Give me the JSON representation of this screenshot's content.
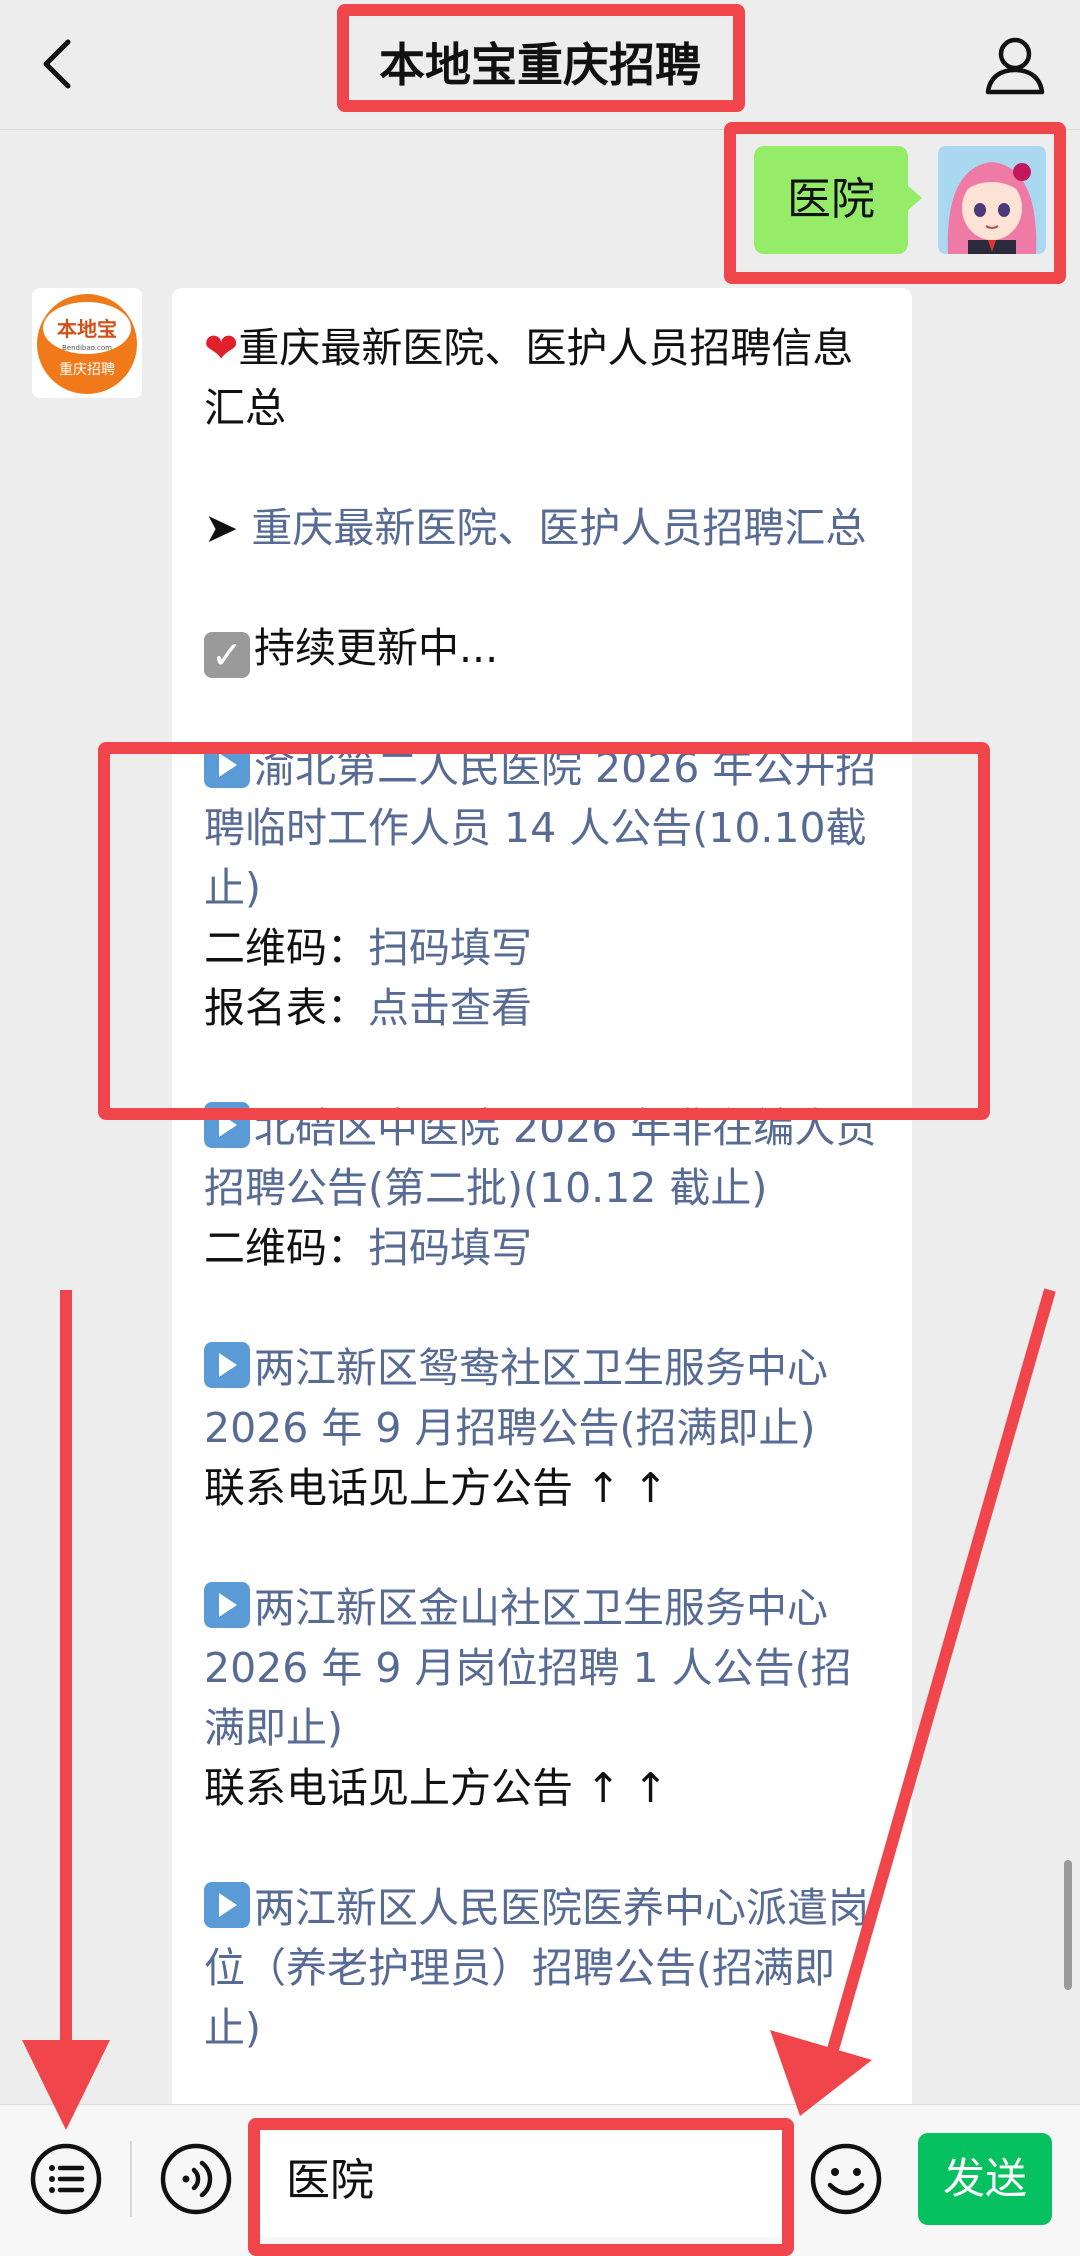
{
  "header": {
    "title": "本地宝重庆招聘",
    "back_icon": "chevron-left-icon",
    "profile_icon": "person-icon"
  },
  "outgoing": {
    "text": "医院"
  },
  "bot_avatar": {
    "brand": "本地宝",
    "domain": "Bendibao.com",
    "subtitle": "重庆招聘"
  },
  "message": {
    "intro": "重庆最新医院、医护人员招聘信息汇总",
    "summary_link": "重庆最新医院、医护人员招聘汇总",
    "status": "持续更新中...",
    "items": [
      {
        "title": "渝北第二人民医院 2026 年公开招聘临时工作人员 14 人公告(10.10截止)",
        "lines": [
          {
            "label": "二维码：",
            "link": "扫码填写"
          },
          {
            "label": "报名表：",
            "link": "点击查看"
          }
        ]
      },
      {
        "title": "北碚区中医院 2026 年非在编人员招聘公告(第二批)(10.12 截止)",
        "lines": [
          {
            "label": "二维码：",
            "link": "扫码填写"
          }
        ]
      },
      {
        "title": "两江新区鸳鸯社区卫生服务中心 2026 年 9 月招聘公告(招满即止)",
        "note": "联系电话见上方公告 ↑ ↑"
      },
      {
        "title": "两江新区金山社区卫生服务中心 2026 年 9 月岗位招聘 1 人公告(招满即止)",
        "note": "联系电话见上方公告 ↑ ↑"
      },
      {
        "title": "两江新区人民医院医养中心派遣岗位（养老护理员）招聘公告(招满即止)"
      }
    ]
  },
  "bottombar": {
    "input_value": "医院",
    "send_label": "发送",
    "menu_icon": "list-menu-icon",
    "voice_icon": "voice-icon",
    "emoji_icon": "emoji-icon"
  },
  "colors": {
    "background": "#ededed",
    "outgoing_bubble": "#95ec69",
    "link": "#576b95",
    "send_button": "#07c160",
    "annotation": "#f0464b"
  }
}
